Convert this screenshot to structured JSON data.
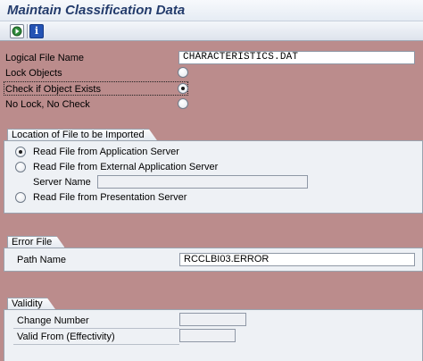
{
  "window": {
    "title": "Maintain Classification Data"
  },
  "toolbar": {
    "execute_icon": "execute-clock-icon",
    "info_icon": "information-icon",
    "info_glyph": "i"
  },
  "form": {
    "logical_file_label": "Logical File Name",
    "logical_file_value": "CHARACTERISTICS.DAT",
    "lock_objects_label": "Lock Objects",
    "check_exists_label": "Check if Object Exists",
    "no_lock_label": "No Lock, No Check",
    "selected_option": "check_exists"
  },
  "location": {
    "title": "Location of File to be Imported",
    "app_server_label": "Read File from Application Server",
    "ext_server_label": "Read File from External Application Server",
    "server_name_label": "Server Name",
    "server_name_value": "",
    "presentation_label": "Read File from Presentation Server",
    "selected_option": "app_server"
  },
  "error_file": {
    "title": "Error File",
    "path_label": "Path Name",
    "path_value": "RCCLBI03.ERROR"
  },
  "validity": {
    "title": "Validity",
    "change_number_label": "Change Number",
    "change_number_value": "",
    "valid_from_label": "Valid From (Effectivity)",
    "valid_from_value": ""
  },
  "colors": {
    "background": "#bb8c8c",
    "group_background": "#eef1f5",
    "title_text": "#243c6c"
  }
}
